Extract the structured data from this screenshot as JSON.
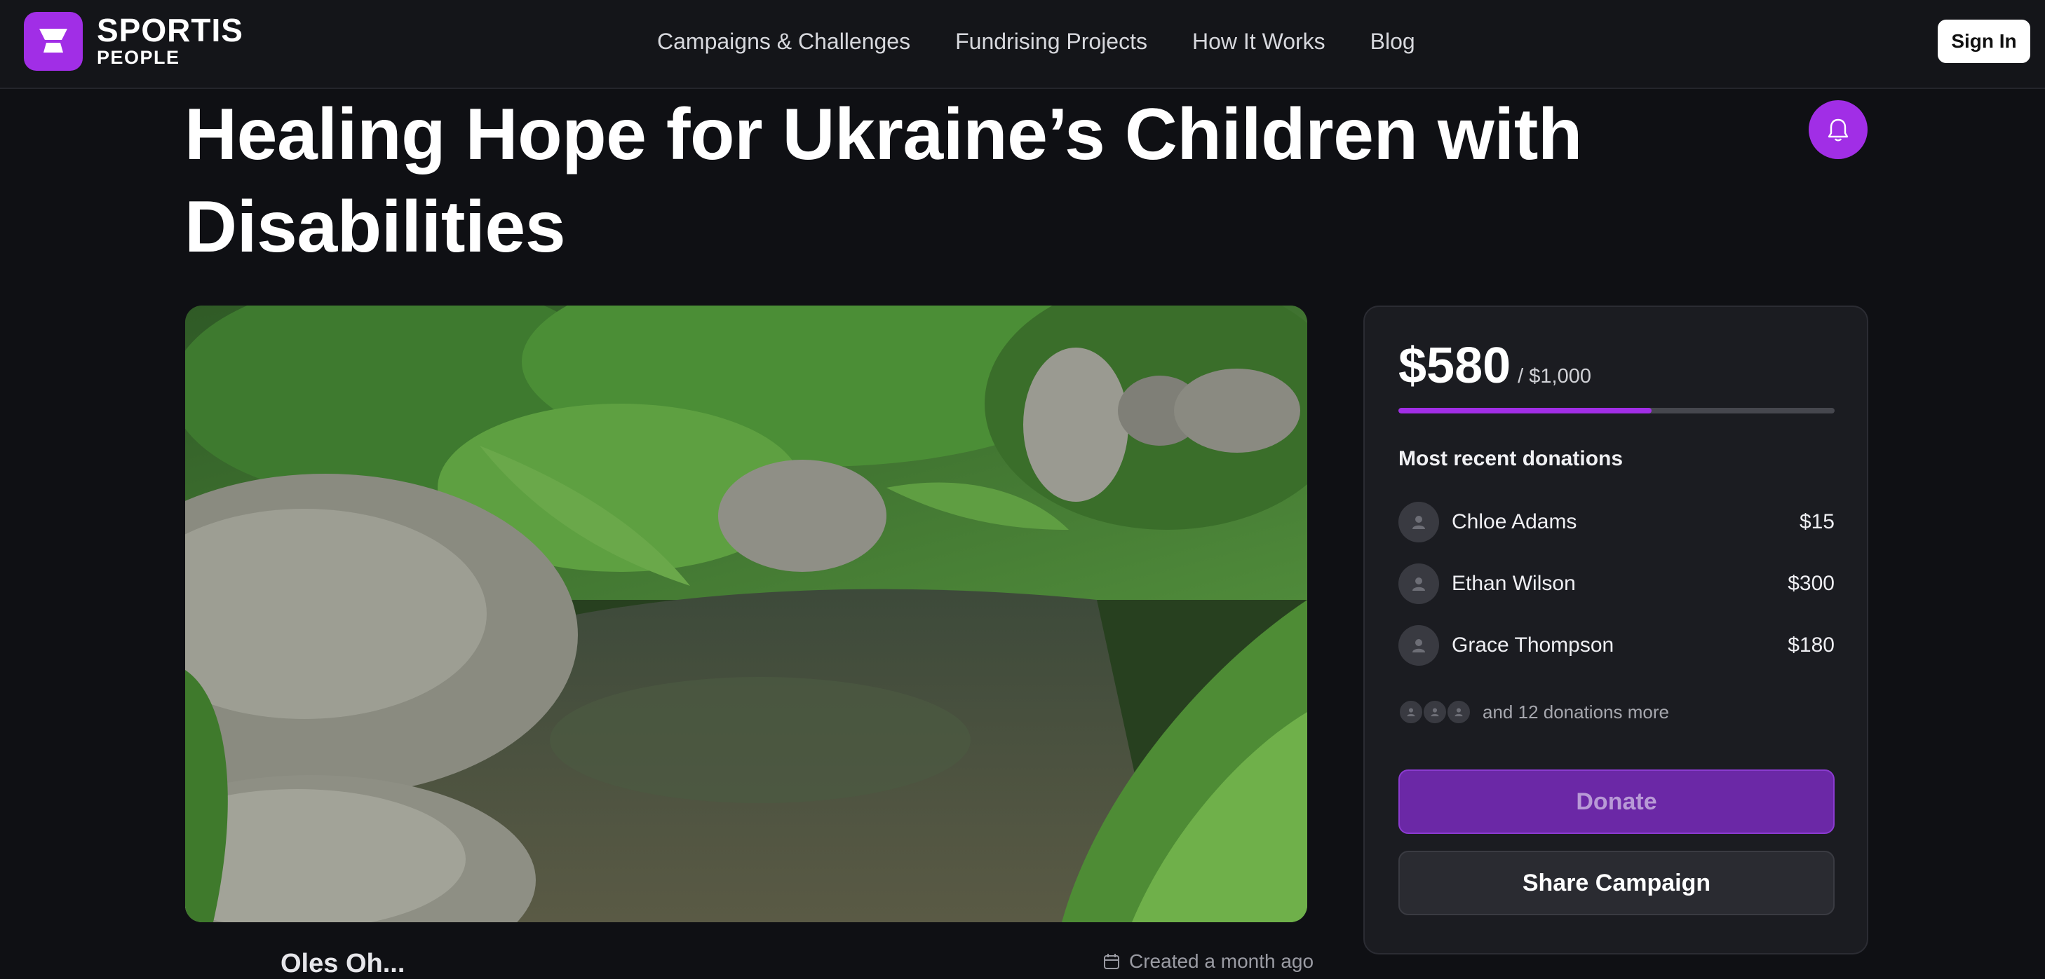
{
  "header": {
    "brand_line1": "SPORTIS",
    "brand_line2": "PEOPLE",
    "nav": [
      {
        "label": "Campaigns & Challenges"
      },
      {
        "label": "Fundrising Projects"
      },
      {
        "label": "How It Works"
      },
      {
        "label": "Blog"
      }
    ],
    "sign_in_label": "Sign In"
  },
  "campaign": {
    "title": "Healing Hope for Ukraine’s Children with Disabilities",
    "notify_icon": "bell-icon",
    "image_description_icon": "landscape-photo",
    "creator_name": "Oles Oh...",
    "created_label": "Created a month ago"
  },
  "donation_card": {
    "raised": "$580",
    "goal": "/ $1,000",
    "progress_fraction": 0.58,
    "recent_heading": "Most recent donations",
    "donors": [
      {
        "name": "Chloe Adams",
        "amount": "$15"
      },
      {
        "name": "Ethan Wilson",
        "amount": "$300"
      },
      {
        "name": "Grace Thompson",
        "amount": "$180"
      }
    ],
    "more_text": "and 12 donations more",
    "donate_label": "Donate",
    "share_label": "Share Campaign"
  },
  "colors": {
    "accent": "#a12ee6",
    "background": "#0f1014",
    "card": "#1b1c21",
    "donate_button": "#6b28a6"
  }
}
